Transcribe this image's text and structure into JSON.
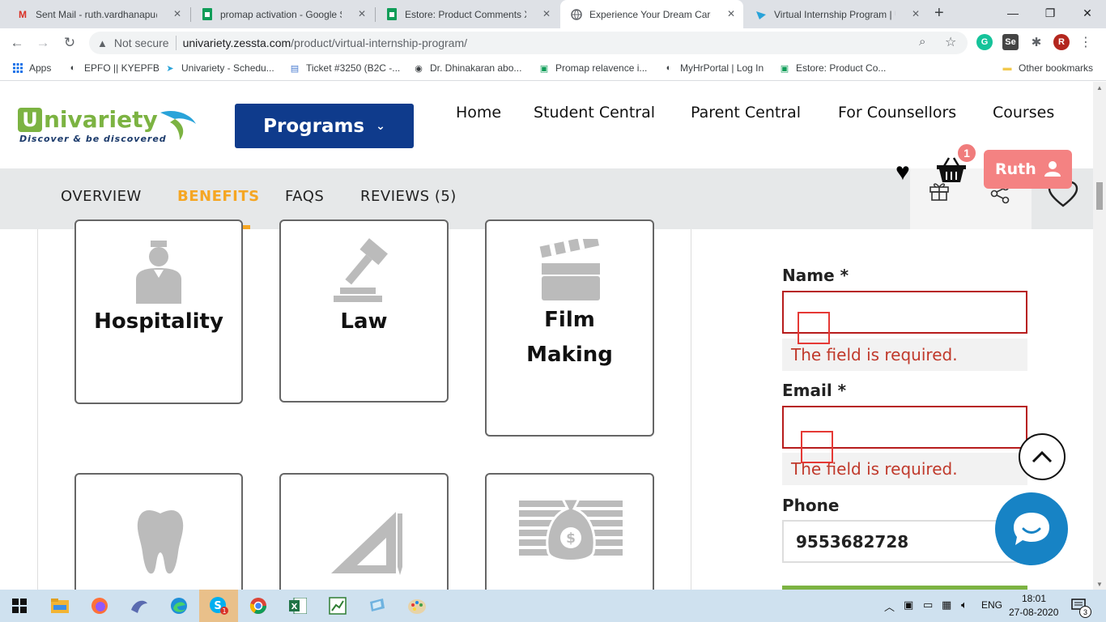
{
  "browser": {
    "tabs": [
      {
        "title": "Sent Mail - ruth.vardhanapu@u"
      },
      {
        "title": "promap activation - Google Sh"
      },
      {
        "title": "Estore: Product Comments XLS"
      },
      {
        "title": "Experience Your Dream Career"
      },
      {
        "title": "Virtual Internship Program | Ur"
      }
    ],
    "address": {
      "security": "Not secure",
      "host": "univariety.zessta.com",
      "path": "/product/virtual-internship-program/"
    },
    "profile_letter": "R",
    "bookmarks": [
      "Apps",
      "EPFO || KYEPFB",
      "Univariety - Schedu...",
      "Ticket #3250 (B2C -...",
      "Dr. Dhinakaran abo...",
      "Promap relavence i...",
      "MyHrPortal | Log In",
      "Estore: Product Co...",
      "Other bookmarks"
    ]
  },
  "site": {
    "logo_text": "nivariety",
    "logo_letter": "U",
    "tagline": "Discover & be discovered",
    "programs_label": "Programs",
    "nav": [
      "Home",
      "Student Central",
      "Parent Central",
      "For Counsellors",
      "Courses"
    ],
    "subnav": [
      "OVERVIEW",
      "BENEFITS",
      "FAQS",
      "REVIEWS (5)"
    ],
    "cart_count": "1",
    "user_name": "Ruth"
  },
  "cards": [
    {
      "label": "Hospitality",
      "icon": "hotel-staff-icon"
    },
    {
      "label": "Law",
      "icon": "gavel-icon"
    },
    {
      "label_line1": "Film",
      "label_line2": "Making",
      "icon": "clapperboard-icon"
    },
    {
      "icon": "tooth-icon"
    },
    {
      "icon": "ruler-triangle-icon"
    },
    {
      "icon": "money-bag-icon"
    }
  ],
  "form": {
    "name_label": "Name *",
    "name_error": "The field is required.",
    "email_label": "Email *",
    "email_error": "The field is required.",
    "phone_label": "Phone",
    "phone_value": "9553682728"
  },
  "taskbar": {
    "lang": "ENG",
    "time": "18:01",
    "date": "27-08-2020",
    "notifications": "3"
  },
  "colors": {
    "brand_blue": "#0f3b8c",
    "accent_orange": "#f5a623",
    "error_red": "#c0392b",
    "user_pink": "#f48282",
    "chat_blue": "#1783c5"
  }
}
